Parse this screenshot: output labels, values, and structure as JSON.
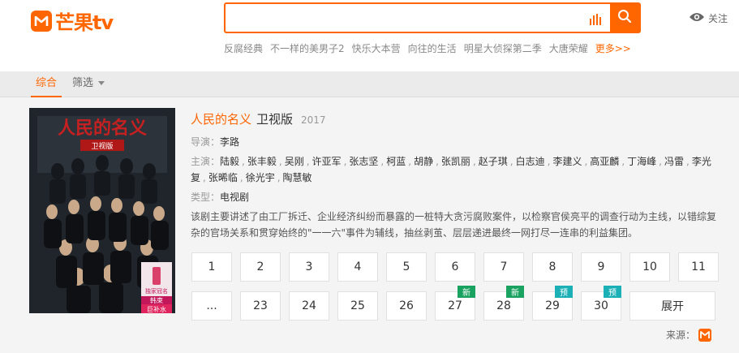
{
  "header": {
    "logo_text": "芒果tv",
    "search": {
      "value": "",
      "placeholder": ""
    },
    "follow_label": "关注",
    "hot_words": [
      "反腐经典",
      "不一样的美男子2",
      "快乐大本营",
      "向往的生活",
      "明星大侦探第二季",
      "大唐荣耀"
    ],
    "more_label": "更多>>"
  },
  "tabs": {
    "zonghe": "综合",
    "filter": "筛选"
  },
  "poster": {
    "title_art": "人民的名义",
    "subtitle_art": "卫视版",
    "promo_line1": "韩束",
    "promo_line2": "巨补水",
    "promo_small": "独家冠名"
  },
  "detail": {
    "title": "人民的名义",
    "title_suffix": "卫视版",
    "year": "2017",
    "director_label": "导演：",
    "director": "李路",
    "cast_label": "主演：",
    "cast": [
      "陆毅",
      "张丰毅",
      "吴刚",
      "许亚军",
      "张志坚",
      "柯蓝",
      "胡静",
      "张凯丽",
      "赵子琪",
      "白志迪",
      "李建义",
      "高亚麟",
      "丁海峰",
      "冯雷",
      "李光复",
      "张晞临",
      "徐光宇",
      "陶慧敏"
    ],
    "type_label": "类型：",
    "type": "电视剧",
    "description": "该剧主要讲述了由工厂拆迁、企业经济纠纷而暴露的一桩特大贪污腐败案件，以检察官侯亮平的调查行动为主线，以错综复杂的官场关系和贯穿始终的\"一一六\"事件为辅线，抽丝剥茧、层层递进最终一网打尽一连串的利益集团。"
  },
  "episodes": {
    "row1": [
      "1",
      "2",
      "3",
      "4",
      "5",
      "6",
      "7",
      "8",
      "9",
      "10",
      "11"
    ],
    "row2": [
      {
        "label": "...",
        "badge": ""
      },
      {
        "label": "23",
        "badge": ""
      },
      {
        "label": "24",
        "badge": ""
      },
      {
        "label": "25",
        "badge": ""
      },
      {
        "label": "26",
        "badge": ""
      },
      {
        "label": "27",
        "badge": "新",
        "badge_color": "#1aa260"
      },
      {
        "label": "28",
        "badge": "新",
        "badge_color": "#1aa260"
      },
      {
        "label": "29",
        "badge": "预",
        "badge_color": "#1bb0b6"
      },
      {
        "label": "30",
        "badge": "预",
        "badge_color": "#1bb0b6"
      }
    ],
    "expand_label": "展开"
  },
  "source": {
    "label": "来源："
  },
  "colors": {
    "brand": "#ff6600",
    "new_badge": "#1aa260",
    "preview_badge": "#1bb0b6"
  }
}
